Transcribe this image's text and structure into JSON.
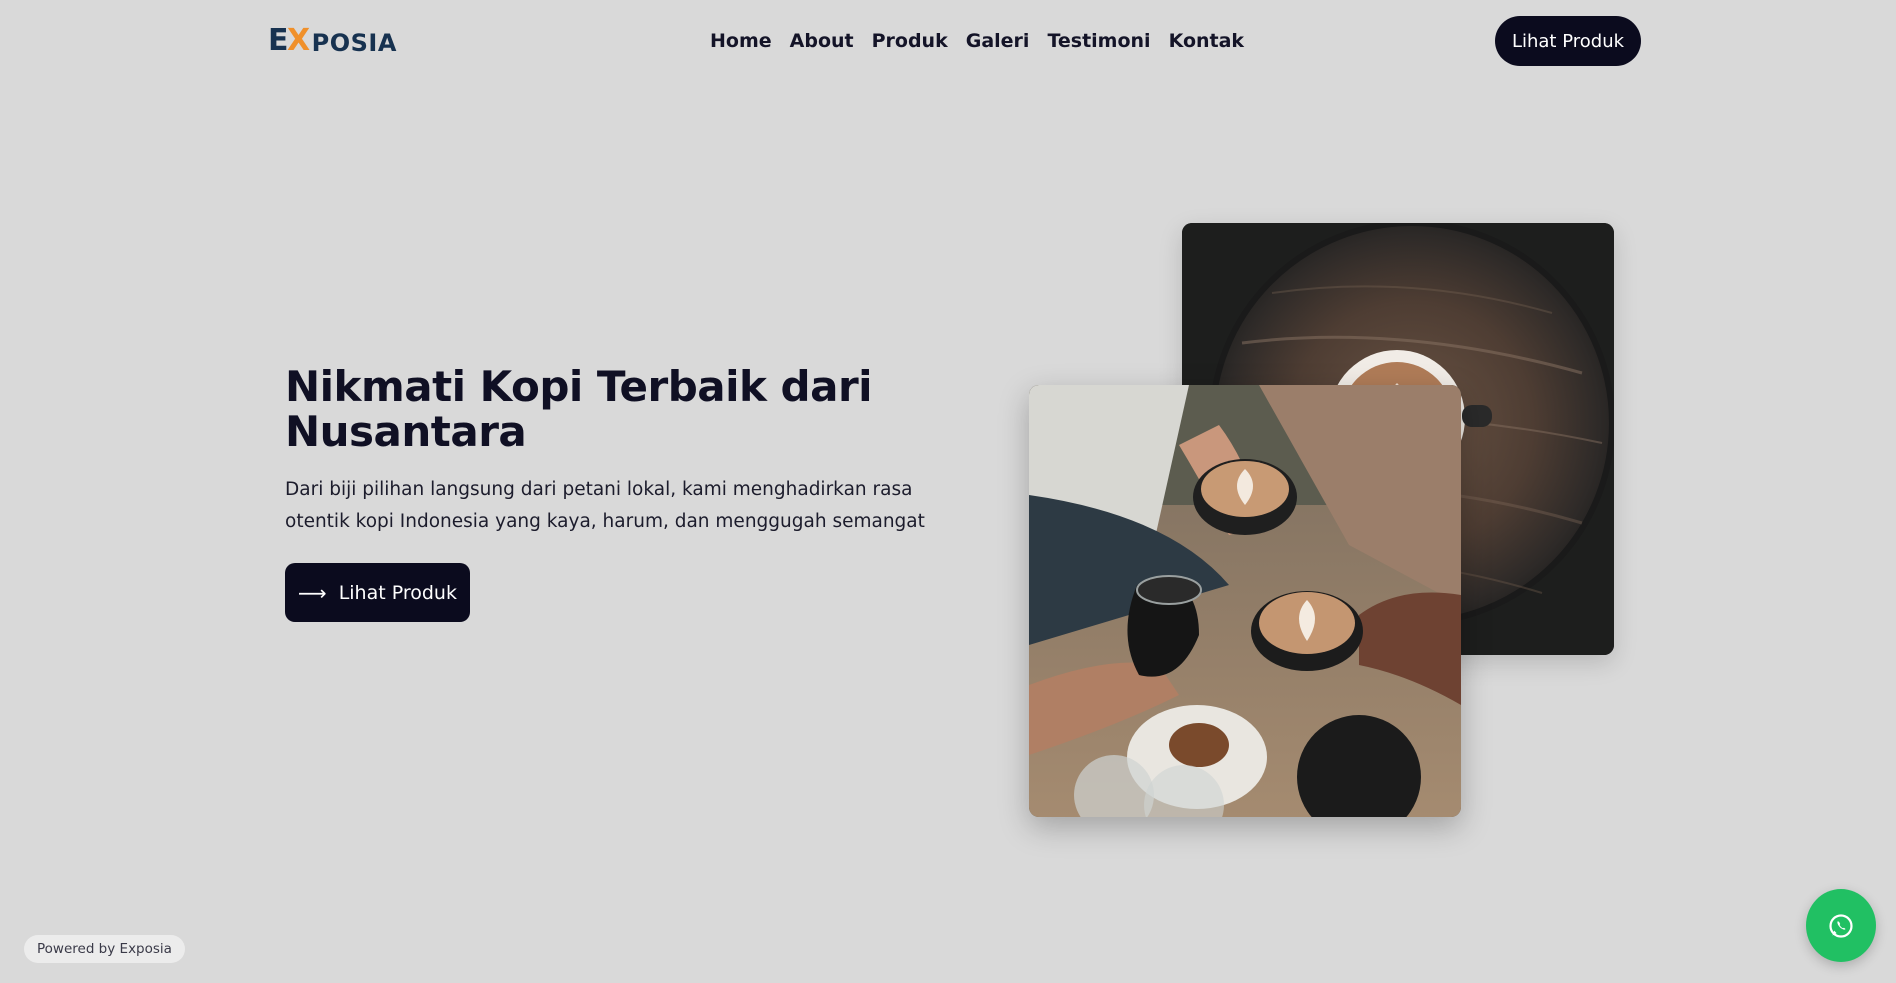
{
  "brand": {
    "logo_e": "E",
    "logo_x": "X",
    "logo_rest": "POSIA",
    "logo_colors": {
      "primary": "#173250",
      "accent": "#f0902a"
    }
  },
  "nav": {
    "items": [
      {
        "label": "Home"
      },
      {
        "label": "About"
      },
      {
        "label": "Produk"
      },
      {
        "label": "Galeri"
      },
      {
        "label": "Testimoni"
      },
      {
        "label": "Kontak"
      }
    ],
    "cta_label": "Lihat Produk"
  },
  "hero": {
    "title": "Nikmati Kopi Terbaik dari Nusantara",
    "description": "Dari biji pilihan langsung dari petani lokal, kami menghadirkan rasa otentik kopi Indonesia yang kaya, harum, dan menggugah semangat",
    "cta_label": "Lihat Produk",
    "cta_icon": "arrow-right-icon"
  },
  "images": {
    "back": {
      "subject": "coffee-cup-on-wooden-table-photo"
    },
    "front": {
      "subject": "people-toasting-coffee-cups-photo"
    }
  },
  "footer": {
    "powered_by": "Powered by Exposia"
  },
  "floating": {
    "icon": "whatsapp-icon",
    "color": "#21c063"
  },
  "theme": {
    "background": "#d9d9d9",
    "dark": "#0b0b1e"
  }
}
